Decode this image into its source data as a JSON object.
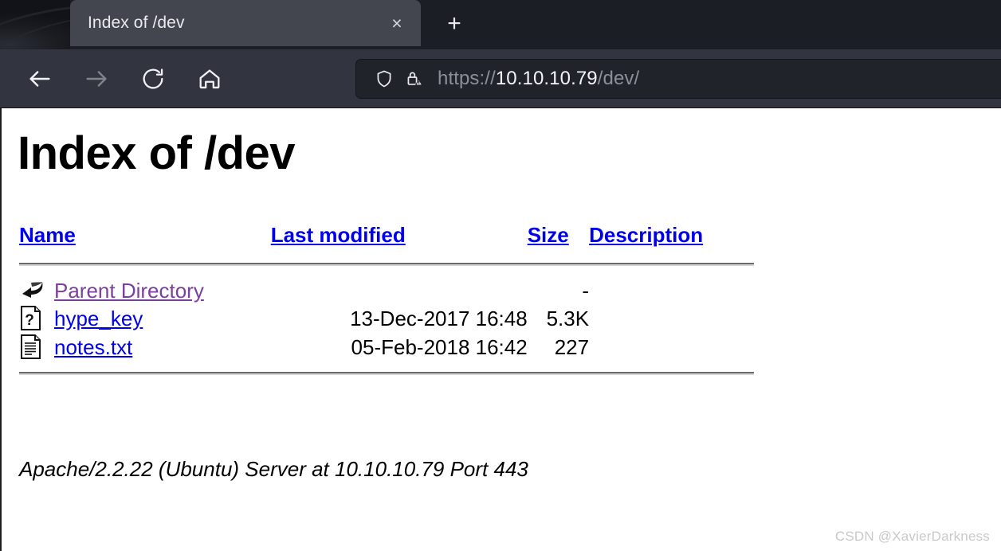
{
  "browser": {
    "tab": {
      "title": "Index of /dev",
      "close_label": "×"
    },
    "new_tab_label": "+",
    "toolbar": {
      "back_label": "Back",
      "forward_label": "Forward",
      "reload_label": "Reload",
      "home_label": "Home"
    },
    "urlbar": {
      "scheme": "https://",
      "host": "10.10.10.79",
      "path": "/dev/",
      "full_url": "https://10.10.10.79/dev/",
      "shield_icon": "shield-icon",
      "lock_warning_icon": "lock-warning-icon"
    }
  },
  "page": {
    "title": "Index of /dev",
    "columns": {
      "icon": "",
      "name": "Name",
      "last_modified": "Last modified",
      "size": "Size",
      "description": "Description"
    },
    "rows": [
      {
        "icon": "parent-directory-icon",
        "name": "Parent Directory",
        "link_state": "visited",
        "last_modified": "",
        "size": "-",
        "description": ""
      },
      {
        "icon": "unknown-file-icon",
        "name": "hype_key",
        "link_state": "new",
        "last_modified": "13-Dec-2017 16:48",
        "size": "5.3K",
        "description": ""
      },
      {
        "icon": "text-file-icon",
        "name": "notes.txt",
        "link_state": "new",
        "last_modified": "05-Feb-2018 16:42",
        "size": "227",
        "description": ""
      }
    ],
    "footer": "Apache/2.2.22 (Ubuntu) Server at 10.10.10.79 Port 443"
  },
  "watermark": "CSDN @XavierDarkness",
  "colors": {
    "link_new": "#0000ee",
    "link_visited": "#7b3fa0",
    "page_background": "#ffffff",
    "tabstrip_background": "#1c1e26",
    "tab_active_background": "#43464f",
    "navbar_background": "#32353f",
    "urlbar_background": "#21232b"
  }
}
